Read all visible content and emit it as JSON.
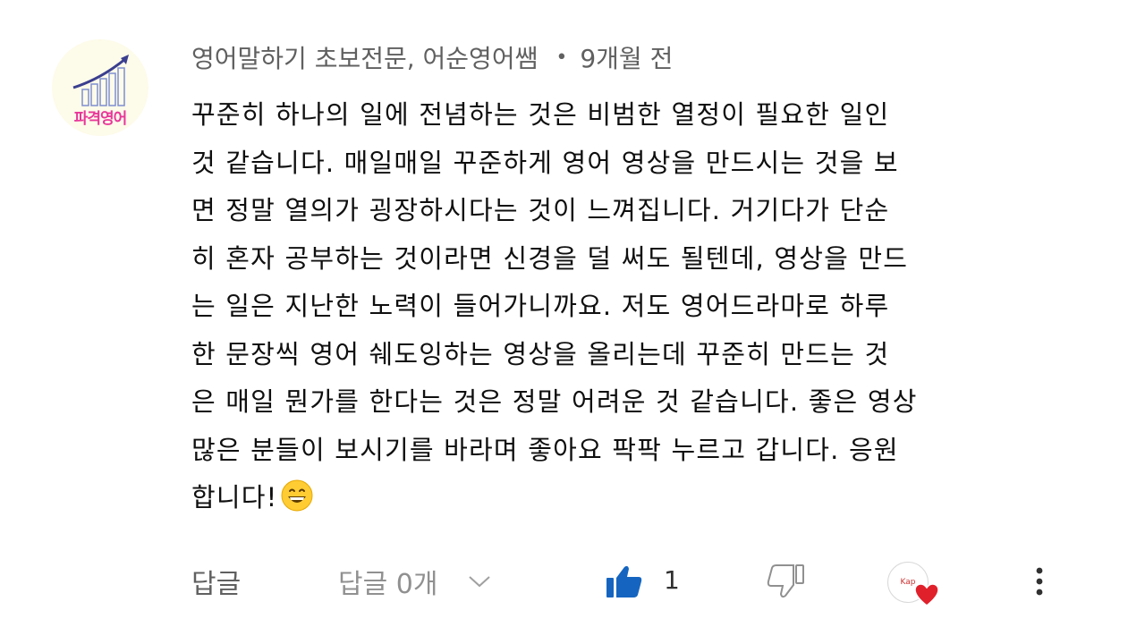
{
  "comment": {
    "avatar_text": "파격영어",
    "author": "영어말하기 초보전문, 어순영어쌤",
    "separator": "•",
    "time": "9개월 전",
    "lines": [
      "꾸준히 하나의 일에 전념하는 것은 비범한 열정이 필요한 일인",
      "것 같습니다. 매일매일 꾸준하게 영어 영상을 만드시는 것을 보",
      "면 정말 열의가 굉장하시다는 것이 느껴집니다. 거기다가 단순",
      "히 혼자 공부하는 것이라면 신경을 덜 써도 될텐데, 영상을 만드",
      "는 일은 지난한 노력이 들어가니까요. 저도 영어드라마로 하루",
      "한 문장씩 영어 쉐도잉하는 영상을 올리는데 꾸준히 만드는 것",
      "은 매일 뭔가를 한다는 것은 정말 어려운 것 같습니다. 좋은 영상",
      "많은 분들이 보시기를 바라며 좋아요 팍팍 누르고 갑니다. 응원",
      "합니다!"
    ],
    "emoji": "grinning-face-emoji"
  },
  "actions": {
    "reply_label": "답글",
    "replies_count_label": "답글 0개",
    "like_count": "1",
    "creator_avatar_text": "Kap"
  },
  "colors": {
    "like_blue": "#1565c0",
    "heart_red": "#e0202b",
    "meta_gray": "#606060",
    "avatar_pink": "#e8379a"
  }
}
